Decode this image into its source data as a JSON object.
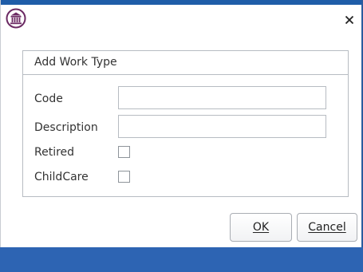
{
  "window": {
    "close_label": "✕",
    "icon": "court-building-icon"
  },
  "group": {
    "title": "Add Work Type"
  },
  "fields": {
    "code": {
      "label": "Code",
      "value": ""
    },
    "description": {
      "label": "Description",
      "value": ""
    },
    "retired": {
      "label": "Retired",
      "checked": false
    },
    "childcare": {
      "label": "ChildCare",
      "checked": false
    }
  },
  "buttons": {
    "ok": "OK",
    "cancel": "Cancel"
  },
  "colors": {
    "accent": "#2d64b3",
    "title_strip": "#1f5da8",
    "icon": "#6b2a63"
  }
}
